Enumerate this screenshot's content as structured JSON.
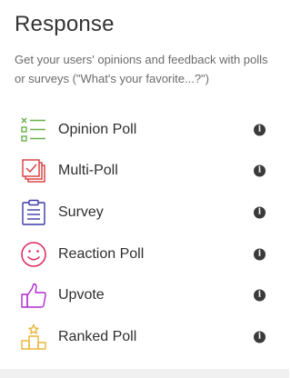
{
  "panel": {
    "title": "Response",
    "description": "Get your users' opinions and feedback with polls or surveys (\"What's your favorite...?\")"
  },
  "items": [
    {
      "label": "Opinion Poll",
      "icon": "opinion-poll-icon",
      "color": "#6ab04c"
    },
    {
      "label": "Multi-Poll",
      "icon": "multi-poll-icon",
      "color": "#d63a3a"
    },
    {
      "label": "Survey",
      "icon": "survey-icon",
      "color": "#3b3ba8"
    },
    {
      "label": "Reaction Poll",
      "icon": "reaction-poll-icon",
      "color": "#e0245e"
    },
    {
      "label": "Upvote",
      "icon": "upvote-icon",
      "color": "#b02ad1"
    },
    {
      "label": "Ranked Poll",
      "icon": "ranked-poll-icon",
      "color": "#e8b53a"
    }
  ],
  "info_glyph": "i"
}
